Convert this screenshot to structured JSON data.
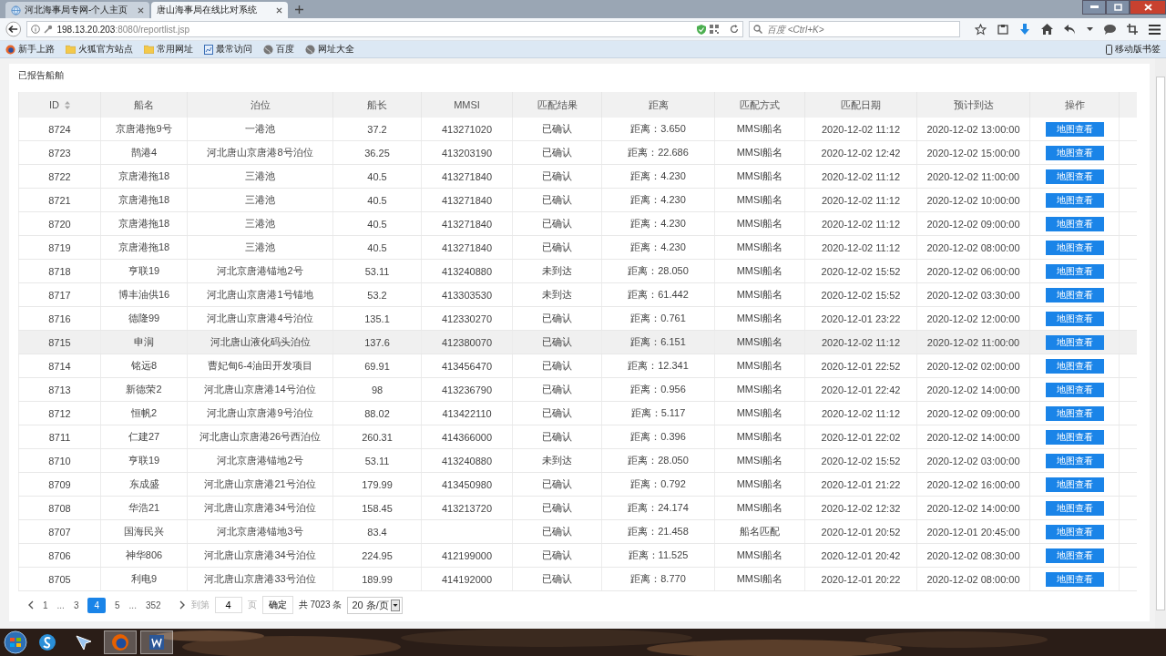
{
  "browser": {
    "tabs": [
      {
        "title": "河北海事局专网-个人主页",
        "selected": false
      },
      {
        "title": "唐山海事局在线比对系统",
        "selected": true
      }
    ],
    "address": {
      "host": "198.13.20.203",
      "path": ":8080/reportlist.jsp"
    },
    "search": {
      "placeholder": "百度 <Ctrl+K>"
    },
    "bookmarks": [
      "新手上路",
      "火狐官方站点",
      "常用网址",
      "最常访问",
      "百度",
      "网址大全"
    ],
    "mobile_bookmarks": "移动版书签"
  },
  "page": {
    "title": "已报告船舶",
    "table": {
      "columns": [
        "ID",
        "船名",
        "泊位",
        "船长",
        "MMSI",
        "匹配结果",
        "距离",
        "匹配方式",
        "匹配日期",
        "预计到达",
        "操作"
      ],
      "rows": [
        {
          "highlighted": false,
          "cells": [
            "8724",
            "京唐港拖9号",
            "一港池",
            "37.2",
            "413271020",
            "已确认",
            "距离：3.650",
            "MMSI船名",
            "2020-12-02 11:12",
            "2020-12-02 13:00:00"
          ],
          "action": "地图查看"
        },
        {
          "highlighted": false,
          "cells": [
            "8723",
            "鹊港4",
            "河北唐山京唐港8号泊位",
            "36.25",
            "413203190",
            "已确认",
            "距离：22.686",
            "MMSI船名",
            "2020-12-02 12:42",
            "2020-12-02 15:00:00"
          ],
          "action": "地图查看"
        },
        {
          "highlighted": false,
          "cells": [
            "8722",
            "京唐港拖18",
            "三港池",
            "40.5",
            "413271840",
            "已确认",
            "距离：4.230",
            "MMSI船名",
            "2020-12-02 11:12",
            "2020-12-02 11:00:00"
          ],
          "action": "地图查看"
        },
        {
          "highlighted": false,
          "cells": [
            "8721",
            "京唐港拖18",
            "三港池",
            "40.5",
            "413271840",
            "已确认",
            "距离：4.230",
            "MMSI船名",
            "2020-12-02 11:12",
            "2020-12-02 10:00:00"
          ],
          "action": "地图查看"
        },
        {
          "highlighted": false,
          "cells": [
            "8720",
            "京唐港拖18",
            "三港池",
            "40.5",
            "413271840",
            "已确认",
            "距离：4.230",
            "MMSI船名",
            "2020-12-02 11:12",
            "2020-12-02 09:00:00"
          ],
          "action": "地图查看"
        },
        {
          "highlighted": false,
          "cells": [
            "8719",
            "京唐港拖18",
            "三港池",
            "40.5",
            "413271840",
            "已确认",
            "距离：4.230",
            "MMSI船名",
            "2020-12-02 11:12",
            "2020-12-02 08:00:00"
          ],
          "action": "地图查看"
        },
        {
          "highlighted": false,
          "cells": [
            "8718",
            "亨联19",
            "河北京唐港锚地2号",
            "53.11",
            "413240880",
            "未到达",
            "距离：28.050",
            "MMSI船名",
            "2020-12-02 15:52",
            "2020-12-02 06:00:00"
          ],
          "action": "地图查看"
        },
        {
          "highlighted": false,
          "cells": [
            "8717",
            "博丰油供16",
            "河北唐山京唐港1号锚地",
            "53.2",
            "413303530",
            "未到达",
            "距离：61.442",
            "MMSI船名",
            "2020-12-02 15:52",
            "2020-12-02 03:30:00"
          ],
          "action": "地图查看"
        },
        {
          "highlighted": false,
          "cells": [
            "8716",
            "德隆99",
            "河北唐山京唐港4号泊位",
            "135.1",
            "412330270",
            "已确认",
            "距离：0.761",
            "MMSI船名",
            "2020-12-01 23:22",
            "2020-12-02 12:00:00"
          ],
          "action": "地图查看"
        },
        {
          "highlighted": true,
          "cells": [
            "8715",
            "申润",
            "河北唐山液化码头泊位",
            "137.6",
            "412380070",
            "已确认",
            "距离：6.151",
            "MMSI船名",
            "2020-12-02 11:12",
            "2020-12-02 11:00:00"
          ],
          "action": "地图查看"
        },
        {
          "highlighted": false,
          "cells": [
            "8714",
            "铭远8",
            "曹妃甸6-4油田开发项目",
            "69.91",
            "413456470",
            "已确认",
            "距离：12.341",
            "MMSI船名",
            "2020-12-01 22:52",
            "2020-12-02 02:00:00"
          ],
          "action": "地图查看"
        },
        {
          "highlighted": false,
          "cells": [
            "8713",
            "新德荣2",
            "河北唐山京唐港14号泊位",
            "98",
            "413236790",
            "已确认",
            "距离：0.956",
            "MMSI船名",
            "2020-12-01 22:42",
            "2020-12-02 14:00:00"
          ],
          "action": "地图查看"
        },
        {
          "highlighted": false,
          "cells": [
            "8712",
            "恒帆2",
            "河北唐山京唐港9号泊位",
            "88.02",
            "413422110",
            "已确认",
            "距离：5.117",
            "MMSI船名",
            "2020-12-02 11:12",
            "2020-12-02 09:00:00"
          ],
          "action": "地图查看"
        },
        {
          "highlighted": false,
          "cells": [
            "8711",
            "仁建27",
            "河北唐山京唐港26号西泊位",
            "260.31",
            "414366000",
            "已确认",
            "距离：0.396",
            "MMSI船名",
            "2020-12-01 22:02",
            "2020-12-02 14:00:00"
          ],
          "action": "地图查看"
        },
        {
          "highlighted": false,
          "cells": [
            "8710",
            "亨联19",
            "河北京唐港锚地2号",
            "53.11",
            "413240880",
            "未到达",
            "距离：28.050",
            "MMSI船名",
            "2020-12-02 15:52",
            "2020-12-02 03:00:00"
          ],
          "action": "地图查看"
        },
        {
          "highlighted": false,
          "cells": [
            "8709",
            "东成盛",
            "河北唐山京唐港21号泊位",
            "179.99",
            "413450980",
            "已确认",
            "距离：0.792",
            "MMSI船名",
            "2020-12-01 21:22",
            "2020-12-02 16:00:00"
          ],
          "action": "地图查看"
        },
        {
          "highlighted": false,
          "cells": [
            "8708",
            "华浩21",
            "河北唐山京唐港34号泊位",
            "158.45",
            "413213720",
            "已确认",
            "距离：24.174",
            "MMSI船名",
            "2020-12-02 12:32",
            "2020-12-02 14:00:00"
          ],
          "action": "地图查看"
        },
        {
          "highlighted": false,
          "cells": [
            "8707",
            "国海民兴",
            "河北京唐港锚地3号",
            "83.4",
            "",
            "已确认",
            "距离：21.458",
            "船名匹配",
            "2020-12-01 20:52",
            "2020-12-01 20:45:00"
          ],
          "action": "地图查看"
        },
        {
          "highlighted": false,
          "cells": [
            "8706",
            "神华806",
            "河北唐山京唐港34号泊位",
            "224.95",
            "412199000",
            "已确认",
            "距离：11.525",
            "MMSI船名",
            "2020-12-01 20:42",
            "2020-12-02 08:30:00"
          ],
          "action": "地图查看"
        },
        {
          "highlighted": false,
          "cells": [
            "8705",
            "利电9",
            "河北唐山京唐港33号泊位",
            "189.99",
            "414192000",
            "已确认",
            "距离：8.770",
            "MMSI船名",
            "2020-12-01 20:22",
            "2020-12-02 08:00:00"
          ],
          "action": "地图查看"
        }
      ]
    },
    "pagination": {
      "pages": [
        {
          "kind": "page",
          "label": "1",
          "selected": false
        },
        {
          "kind": "ellipsis",
          "label": "..."
        },
        {
          "kind": "page",
          "label": "3",
          "selected": false
        },
        {
          "kind": "page",
          "label": "4",
          "selected": true
        },
        {
          "kind": "page",
          "label": "5",
          "selected": false
        },
        {
          "kind": "ellipsis",
          "label": "..."
        },
        {
          "kind": "page",
          "label": "352",
          "selected": false
        }
      ],
      "goto_label": "到第",
      "goto_value": "4",
      "page_unit": "页",
      "confirm": "确定",
      "total": "共 7023 条",
      "page_size": "20 条/页"
    }
  }
}
